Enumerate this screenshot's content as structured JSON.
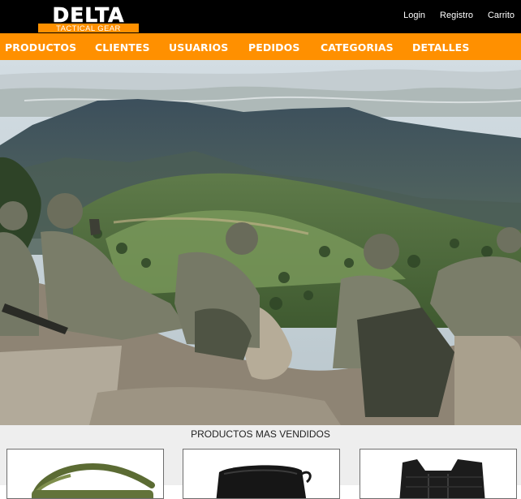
{
  "header": {
    "logo": {
      "main": "DELTA",
      "sub": "TACTICAL GEAR"
    },
    "account_links": [
      {
        "label": "Login"
      },
      {
        "label": "Registro"
      },
      {
        "label": "Carrito"
      }
    ]
  },
  "nav": {
    "items": [
      {
        "label": "PRODUCTOS"
      },
      {
        "label": "CLIENTES"
      },
      {
        "label": "USUARIOS"
      },
      {
        "label": "PEDIDOS"
      },
      {
        "label": "CATEGORIAS"
      },
      {
        "label": "DETALLES"
      }
    ]
  },
  "hero": {
    "image": "soldiers-overlooking-mountain-valley"
  },
  "best_sellers": {
    "title": "PRODUCTOS MAS VENDIDOS",
    "products": [
      {
        "image": "olive-tactical-sling-bag"
      },
      {
        "image": "black-tactical-pouch"
      },
      {
        "image": "black-tactical-vest"
      }
    ]
  },
  "colors": {
    "topbar": "#000000",
    "nav": "#ff9000",
    "logo_accent": "#ff9000",
    "section_bg": "#eeeeee"
  }
}
